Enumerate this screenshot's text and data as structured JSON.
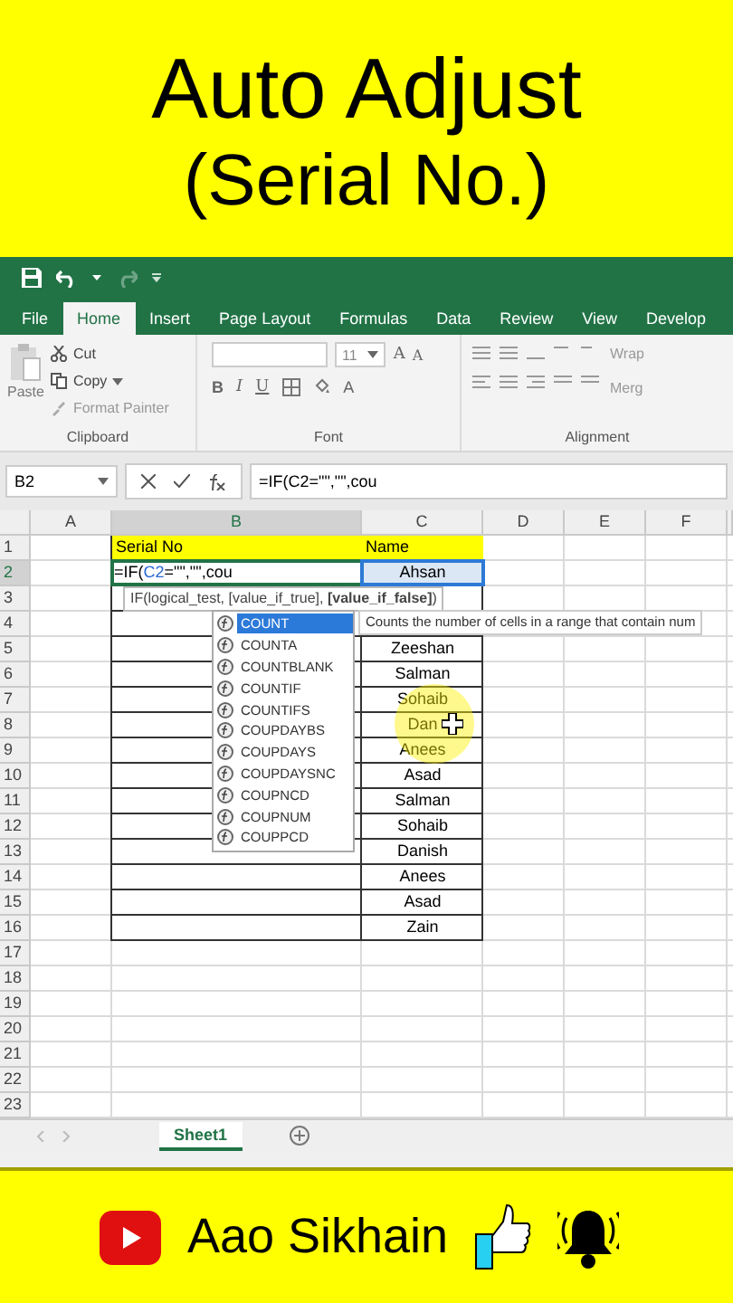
{
  "top_banner": {
    "lines": [
      "Auto Adjust",
      "(Serial No.)"
    ]
  },
  "tabs": [
    {
      "label": "File",
      "selected": false
    },
    {
      "label": "Home",
      "selected": true
    },
    {
      "label": "Insert",
      "selected": false
    },
    {
      "label": "Page Layout",
      "selected": false
    },
    {
      "label": "Formulas",
      "selected": false
    },
    {
      "label": "Data",
      "selected": false
    },
    {
      "label": "Review",
      "selected": false
    },
    {
      "label": "View",
      "selected": false
    },
    {
      "label": "Develop",
      "selected": false
    }
  ],
  "ribbon": {
    "clipboard": {
      "paste": "Paste",
      "cut": "Cut",
      "copy": "Copy",
      "format_painter": "Format Painter",
      "label": "Clipboard"
    },
    "font": {
      "size": "11",
      "bold": "B",
      "italic": "I",
      "underline": "U",
      "font_color": "A",
      "grow": "A",
      "shrink": "A",
      "label": "Font"
    },
    "alignment": {
      "wrap": "Wrap",
      "merge": "Merg",
      "label": "Alignment"
    }
  },
  "formula_bar": {
    "name_box": "B2",
    "formula": "=IF(C2=\"\",\"\",cou"
  },
  "columns": [
    {
      "label": "A",
      "selected": false
    },
    {
      "label": "B",
      "selected": true
    },
    {
      "label": "C",
      "selected": false
    },
    {
      "label": "D",
      "selected": false
    },
    {
      "label": "E",
      "selected": false
    },
    {
      "label": "F",
      "selected": false
    }
  ],
  "rows": [
    {
      "n": "1",
      "kind": "heading",
      "b": "Serial No",
      "c": "Name",
      "selected": false,
      "c_selected": false
    },
    {
      "n": "2",
      "kind": "table",
      "b_parts": [
        "=IF(",
        "C2",
        "=\"\",\"\",cou"
      ],
      "c": "Ahsan",
      "selected": true,
      "c_selected": true
    },
    {
      "n": "3",
      "kind": "table",
      "selected": false,
      "c_selected": false
    },
    {
      "n": "4",
      "kind": "table",
      "selected": false,
      "c_selected": false
    },
    {
      "n": "5",
      "kind": "table",
      "c": "Zeeshan",
      "selected": false,
      "c_selected": false
    },
    {
      "n": "6",
      "kind": "table",
      "c": "Salman",
      "selected": false,
      "c_selected": false
    },
    {
      "n": "7",
      "kind": "table",
      "c": "Sohaib",
      "selected": false,
      "c_selected": false
    },
    {
      "n": "8",
      "kind": "table",
      "c": "Dan",
      "selected": false,
      "c_selected": false
    },
    {
      "n": "9",
      "kind": "table",
      "c": "Anees",
      "selected": false,
      "c_selected": false
    },
    {
      "n": "10",
      "kind": "table",
      "c": "Asad",
      "selected": false,
      "c_selected": false
    },
    {
      "n": "11",
      "kind": "table",
      "c": "Salman",
      "selected": false,
      "c_selected": false
    },
    {
      "n": "12",
      "kind": "table",
      "c": "Sohaib",
      "selected": false,
      "c_selected": false
    },
    {
      "n": "13",
      "kind": "table",
      "c": "Danish",
      "selected": false,
      "c_selected": false
    },
    {
      "n": "14",
      "kind": "table",
      "c": "Anees",
      "selected": false,
      "c_selected": false
    },
    {
      "n": "15",
      "kind": "table",
      "c": "Asad",
      "selected": false,
      "c_selected": false
    },
    {
      "n": "16",
      "kind": "table",
      "c": "Zain",
      "selected": false,
      "c_selected": false
    },
    {
      "n": "17",
      "kind": "blank",
      "selected": false,
      "c_selected": false
    },
    {
      "n": "18",
      "kind": "blank",
      "selected": false,
      "c_selected": false
    },
    {
      "n": "19",
      "kind": "blank",
      "selected": false,
      "c_selected": false
    },
    {
      "n": "20",
      "kind": "blank",
      "selected": false,
      "c_selected": false
    },
    {
      "n": "21",
      "kind": "blank",
      "selected": false,
      "c_selected": false
    },
    {
      "n": "22",
      "kind": "blank",
      "selected": false,
      "c_selected": false
    },
    {
      "n": "23",
      "kind": "blank",
      "selected": false,
      "c_selected": false
    }
  ],
  "syntax_tooltip": "IF(logical_test, [value_if_true], **[value_if_false]**)",
  "autocomplete": [
    {
      "label": "COUNT",
      "selected": true
    },
    {
      "label": "COUNTA",
      "selected": false
    },
    {
      "label": "COUNTBLANK",
      "selected": false
    },
    {
      "label": "COUNTIF",
      "selected": false
    },
    {
      "label": "COUNTIFS",
      "selected": false
    },
    {
      "label": "COUPDAYBS",
      "selected": false
    },
    {
      "label": "COUPDAYS",
      "selected": false
    },
    {
      "label": "COUPDAYSNC",
      "selected": false
    },
    {
      "label": "COUPNCD",
      "selected": false
    },
    {
      "label": "COUPNUM",
      "selected": false
    },
    {
      "label": "COUPPCD",
      "selected": false
    }
  ],
  "function_description": "Counts the number of cells in a range that contain num",
  "sheet_tabs": [
    {
      "label": "Sheet1",
      "selected": true
    }
  ],
  "bottom_banner": {
    "channel": "Aao Sikhain"
  }
}
